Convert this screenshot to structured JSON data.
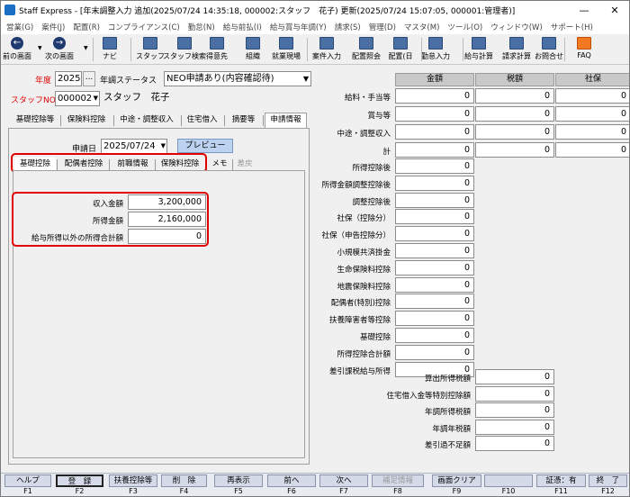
{
  "window": {
    "title": "Staff Express - [年末調整入力 追加(2025/07/24 14:35:18, 000002:スタッフ　花子) 更新(2025/07/24 15:07:05, 000001:管理者)]",
    "minimize": "—",
    "close": "✕"
  },
  "menu": [
    "営業(G)",
    "案件(J)",
    "配置(R)",
    "コンプライアンス(C)",
    "勤怠(N)",
    "給与前払(I)",
    "給与賞与年調(Y)",
    "請求(S)",
    "管理(D)",
    "マスタ(M)",
    "ツール(O)",
    "ウィンドウ(W)",
    "サポート(H)"
  ],
  "toolbar": [
    "前の画面",
    "次の画面",
    "ナビ",
    "スタッフ",
    "スタッフ検索",
    "得意先",
    "組織",
    "就業現場",
    "案件入力",
    "配置照会",
    "配置(日",
    "勤怠入力",
    "給与計算",
    "請求計算",
    "お問合せ",
    "FAQ"
  ],
  "form": {
    "year_label": "年度",
    "year_value": "2025",
    "ellipsis": "...",
    "status_label": "年調ステータス",
    "status_value": "NEO申請あり(内容確認待)",
    "staff_label": "スタッフNO",
    "staff_no": "000002",
    "staff_name": "スタッフ　花子",
    "tabs": [
      "基礎控除等",
      "保険料控除",
      "中途・調整収入",
      "住宅借入",
      "摘要等",
      "申請情報"
    ],
    "apply_date_label": "申請日",
    "apply_date": "2025/07/24",
    "preview": "プレビュー",
    "subtabs": [
      "基礎控除",
      "配偶者控除",
      "前職情報",
      "保険料控除",
      "メモ",
      "差戻"
    ],
    "income_label": "収入金額",
    "income_value": "3,200,000",
    "earned_label": "所得金額",
    "earned_value": "2,160,000",
    "other_label": "給与所得以外の所得合計額",
    "other_value": "0"
  },
  "right": {
    "headers": [
      "金額",
      "税額",
      "社保"
    ],
    "top_rows": [
      {
        "label": "給料・手当等",
        "v": [
          "0",
          "0",
          "0"
        ]
      },
      {
        "label": "賞与等",
        "v": [
          "0",
          "0",
          "0"
        ]
      },
      {
        "label": "中途・調整収入",
        "v": [
          "0",
          "0",
          "0"
        ]
      },
      {
        "label": "計",
        "v": [
          "0",
          "0",
          "0"
        ]
      }
    ],
    "mid_rows": [
      {
        "label": "所得控除後",
        "v": "0"
      },
      {
        "label": "所得金額調整控除後",
        "v": "0"
      },
      {
        "label": "調整控除後",
        "v": "0"
      },
      {
        "label": "社保（控除分）",
        "v": "0"
      },
      {
        "label": "社保（申告控除分）",
        "v": "0"
      },
      {
        "label": "小規模共済掛金",
        "v": "0"
      },
      {
        "label": "生命保険料控除",
        "v": "0"
      },
      {
        "label": "地震保険料控除",
        "v": "0"
      },
      {
        "label": "配偶者(特別)控除",
        "v": "0"
      },
      {
        "label": "扶養障害者等控除",
        "v": "0"
      },
      {
        "label": "基礎控除",
        "v": "0"
      },
      {
        "label": "所得控除合計額",
        "v": "0"
      },
      {
        "label": "差引課税給与所得",
        "v": "0"
      }
    ],
    "bot_rows": [
      {
        "label": "算出所得税額",
        "v": "0"
      },
      {
        "label": "住宅借入金等特別控除額",
        "v": "0"
      },
      {
        "label": "年調所得税額",
        "v": "0"
      },
      {
        "label": "年調年税額",
        "v": "0"
      },
      {
        "label": "差引過不足額",
        "v": "0"
      }
    ]
  },
  "fkeys": [
    {
      "n": "F1",
      "l": "ヘルプ"
    },
    {
      "n": "F2",
      "l": "登　録"
    },
    {
      "n": "F3",
      "l": "扶養控除等"
    },
    {
      "n": "F4",
      "l": "削　除"
    },
    {
      "n": "F5",
      "l": "再表示"
    },
    {
      "n": "F6",
      "l": "前へ"
    },
    {
      "n": "F7",
      "l": "次へ"
    },
    {
      "n": "F8",
      "l": "補足情報"
    },
    {
      "n": "F9",
      "l": "画面クリア"
    },
    {
      "n": "F10",
      "l": ""
    },
    {
      "n": "F11",
      "l": "証憑：有"
    },
    {
      "n": "F12",
      "l": "終　了"
    }
  ]
}
